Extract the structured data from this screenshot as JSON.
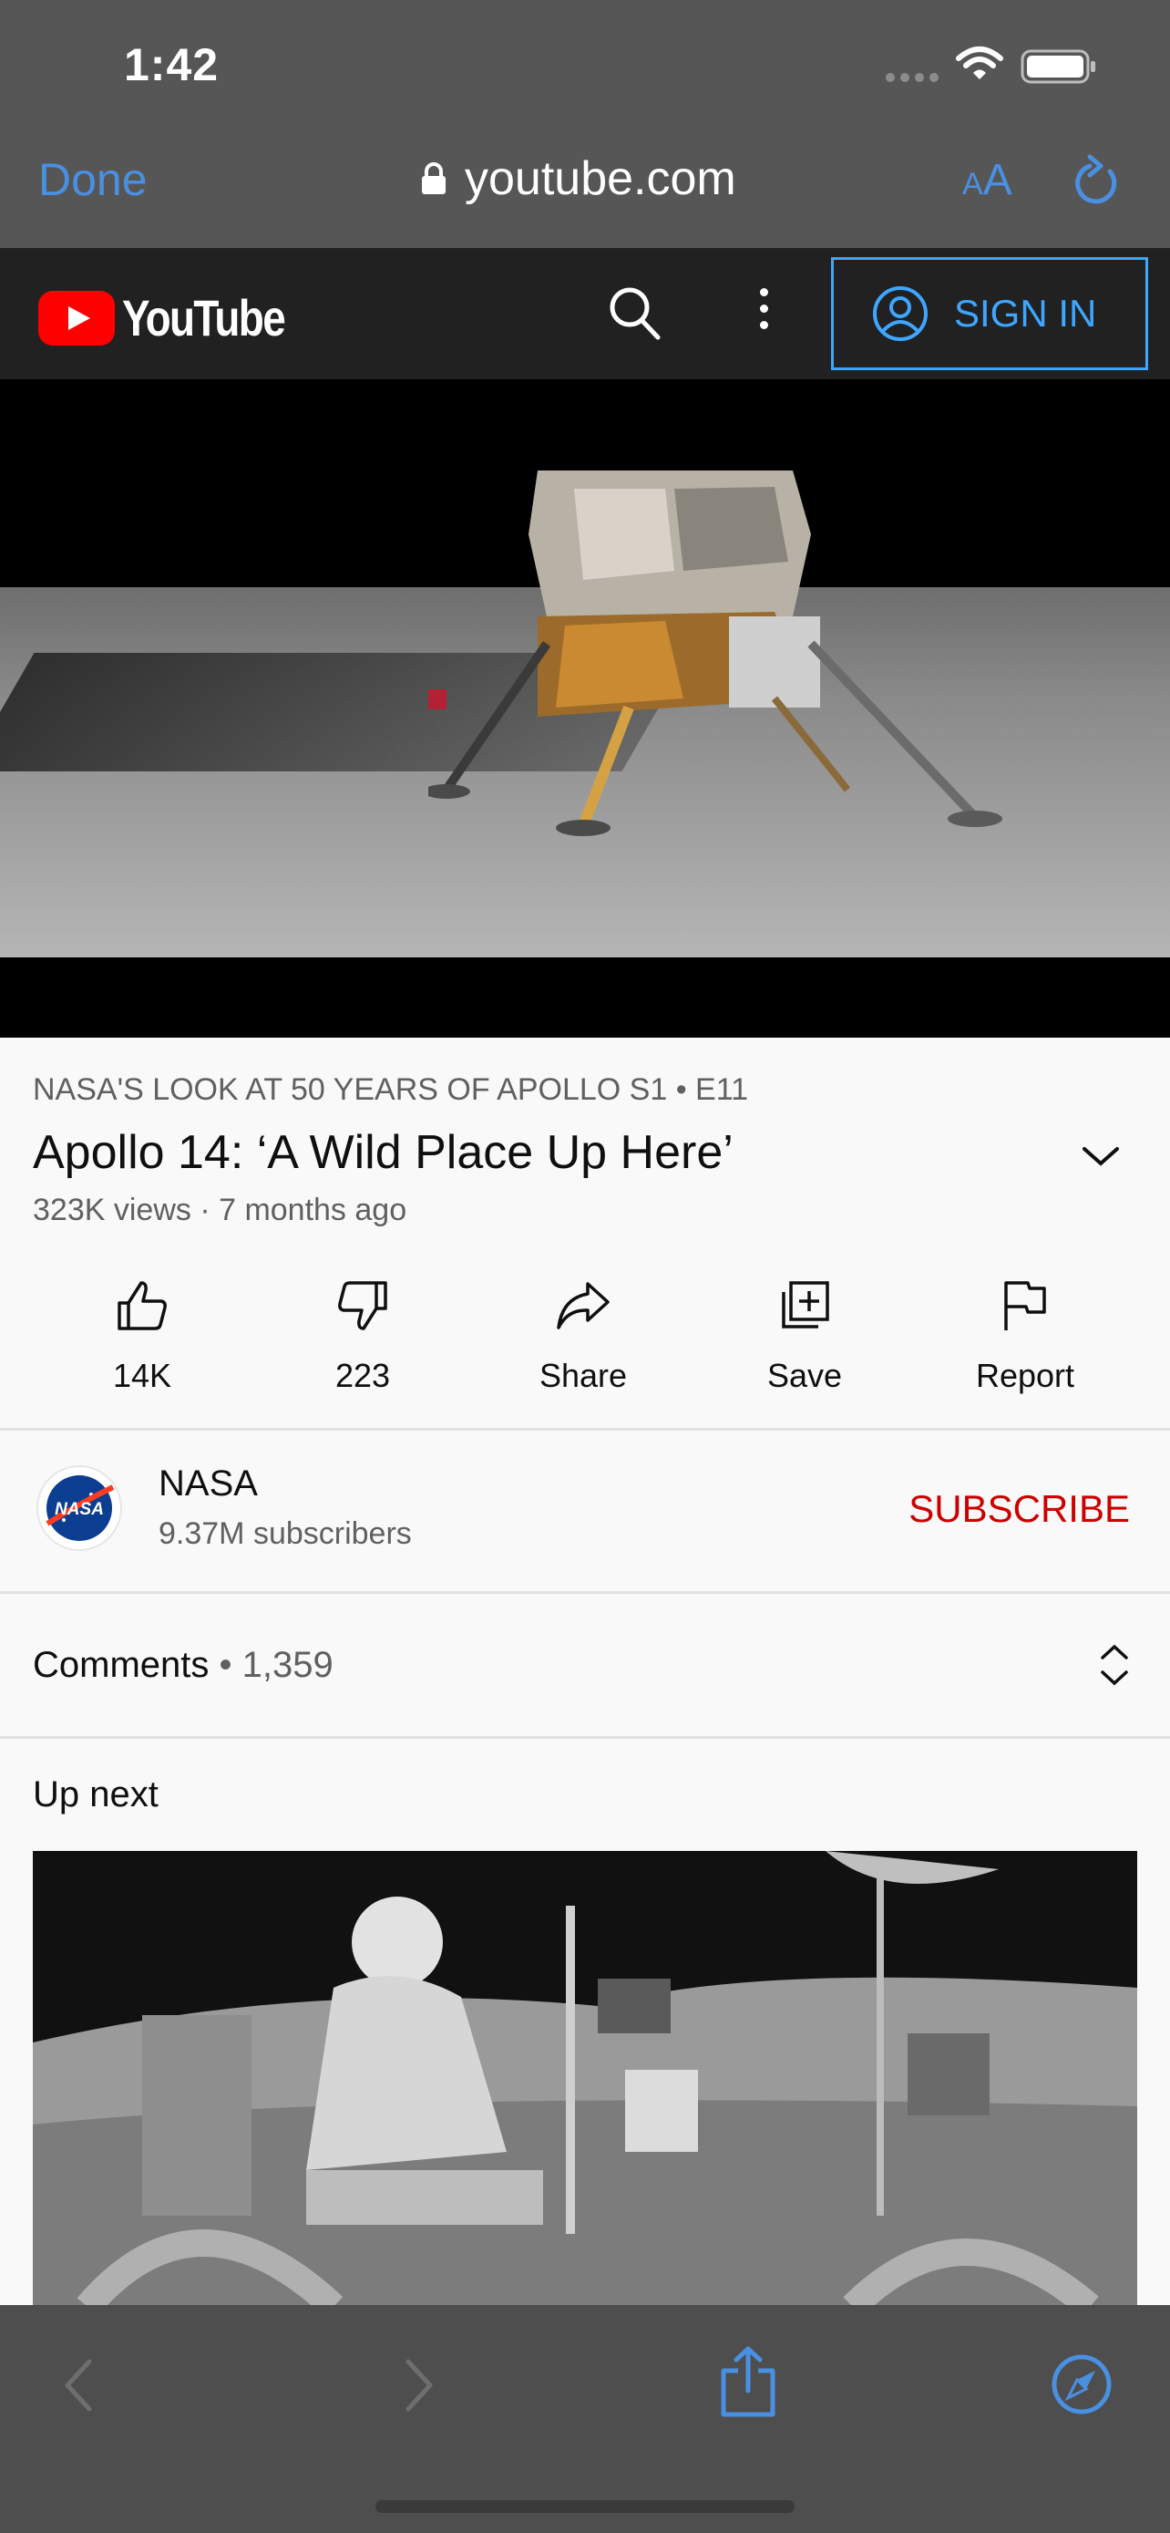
{
  "status_bar": {
    "time": "1:42"
  },
  "safari": {
    "done_label": "Done",
    "url": "youtube.com",
    "aa_small": "A",
    "aa_large": "A"
  },
  "youtube_header": {
    "logo_text": "YouTube",
    "sign_in_label": "SIGN IN"
  },
  "video": {
    "series": "NASA'S LOOK AT 50 YEARS OF APOLLO  S1 • E11",
    "title": "Apollo 14: ‘A Wild Place Up Here’",
    "meta": "323K views · 7 months ago",
    "actions": [
      {
        "icon": "thumbs-up-icon",
        "label": "14K"
      },
      {
        "icon": "thumbs-down-icon",
        "label": "223"
      },
      {
        "icon": "share-icon",
        "label": "Share"
      },
      {
        "icon": "save-icon",
        "label": "Save"
      },
      {
        "icon": "flag-icon",
        "label": "Report"
      }
    ]
  },
  "channel": {
    "name": "NASA",
    "subscribers": "9.37M subscribers",
    "subscribe_label": "SUBSCRIBE",
    "avatar_text": "NASA"
  },
  "comments": {
    "label": "Comments",
    "count": " • 1,359"
  },
  "up_next": {
    "label": "Up next"
  },
  "colors": {
    "link_blue": "#4a90e2",
    "youtube_red": "#ff0000",
    "subscribe_red": "#cc0000",
    "sign_in_blue": "#3ea6ff"
  }
}
